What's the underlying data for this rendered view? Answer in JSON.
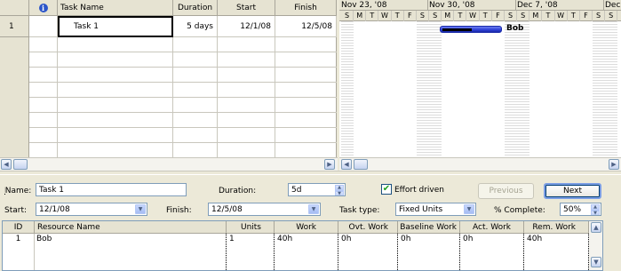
{
  "task_grid": {
    "columns": [
      "",
      "Task Name",
      "Duration",
      "Start",
      "Finish"
    ],
    "rows": [
      {
        "id": "1",
        "name": "Task 1",
        "duration": "5 days",
        "start": "12/1/08",
        "finish": "12/5/08"
      }
    ]
  },
  "gantt": {
    "weeks": [
      "Nov 23, '08",
      "Nov 30, '08",
      "Dec 7, '08",
      "Dec"
    ],
    "days": [
      "S",
      "M",
      "T",
      "W",
      "T",
      "F",
      "S",
      "S",
      "M",
      "T",
      "W",
      "T",
      "F",
      "S",
      "S",
      "M",
      "T",
      "W",
      "T",
      "F",
      "S",
      "S"
    ],
    "bar_resource_label": "Bob",
    "bar_color": "#2d3fd6"
  },
  "form": {
    "name_label": "Name:",
    "name_value": "Task 1",
    "duration_label": "Duration:",
    "duration_value": "5d",
    "effort_driven_label": "Effort driven",
    "effort_driven_checked": true,
    "previous_label": "Previous",
    "next_label": "Next",
    "start_label": "Start:",
    "start_value": "12/1/08",
    "finish_label": "Finish:",
    "finish_value": "12/5/08",
    "task_type_label": "Task type:",
    "task_type_value": "Fixed Units",
    "pct_complete_label": "% Complete:",
    "pct_complete_value": "50%"
  },
  "resource_table": {
    "columns": [
      "ID",
      "Resource Name",
      "Units",
      "Work",
      "Ovt. Work",
      "Baseline Work",
      "Act. Work",
      "Rem. Work"
    ],
    "rows": [
      {
        "id": "1",
        "name": "Bob",
        "units": "1",
        "work": "40h",
        "ovt": "0h",
        "baseline": "0h",
        "act": "0h",
        "rem": "40h"
      }
    ]
  }
}
